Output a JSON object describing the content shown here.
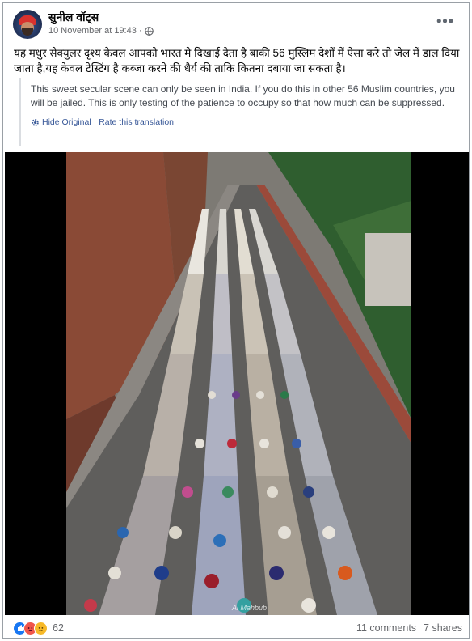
{
  "post": {
    "author": "सुनील वॉट्स",
    "timestamp": "10 November at 19:43",
    "separator": "·",
    "hindi_text": "यह मधुर सेक्युलर दृश्य केवल आपको भारत मे दिखाई देता है बाकी 56 मुस्लिम देशों में ऐसा करे तो जेल में डाल दिया जाता है,यह केवल टेस्टिंग है कब्जा करने की धैर्य की ताकि कितना दबाया जा सकता है।",
    "translation": {
      "text": "This sweet secular scene can only be seen in India. If you do this in other 56 Muslim countries, you will be jailed. This is only testing of the patience to occupy so that how much can be suppressed.",
      "hide_label": "Hide Original",
      "dot": "·",
      "rate_label": "Rate this translation"
    },
    "photo_watermark": "Al Mahbub",
    "icons": {
      "privacy": "globe-icon",
      "more": "more-options-icon",
      "settings": "gear-icon"
    }
  },
  "footer": {
    "reaction_count": "62",
    "reactions": [
      "like",
      "angry",
      "sad"
    ],
    "comments": "11 comments",
    "shares": "7 shares"
  },
  "colors": {
    "link": "#385898",
    "meta": "#65676b",
    "like": "#1877f2"
  }
}
